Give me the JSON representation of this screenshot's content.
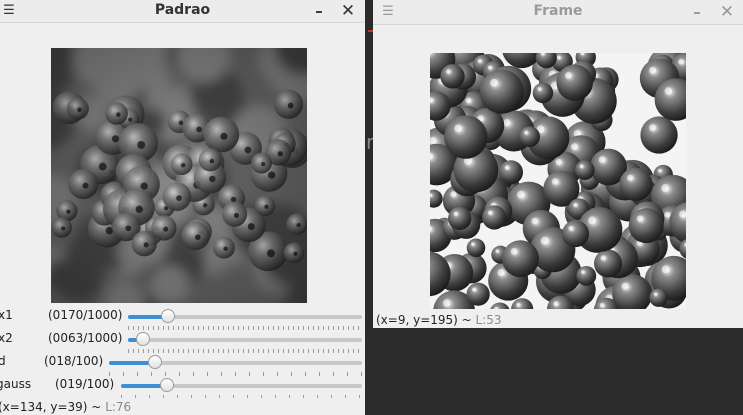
{
  "padrao_window": {
    "title": "Padrao",
    "status": "(x=134, y=39) ~",
    "status_luma": "L:76",
    "trackbars": [
      {
        "label": "x1",
        "value_text": "(0170/1000)",
        "value": 170,
        "max": 1000
      },
      {
        "label": "x2",
        "value_text": "(0063/1000)",
        "value": 63,
        "max": 1000
      },
      {
        "label": "d",
        "value_text": "(018/100)",
        "value": 18,
        "max": 100
      },
      {
        "label": "gauss",
        "value_text": "(019/100)",
        "value": 19,
        "max": 100
      }
    ]
  },
  "frame_window": {
    "title": "Frame",
    "status": "(x=9, y=195) ~",
    "status_luma": "L:53"
  },
  "background_glyph": "r",
  "icons": {
    "menu": "menu-icon",
    "minimize": "minimize-icon",
    "close": "close-icon"
  }
}
